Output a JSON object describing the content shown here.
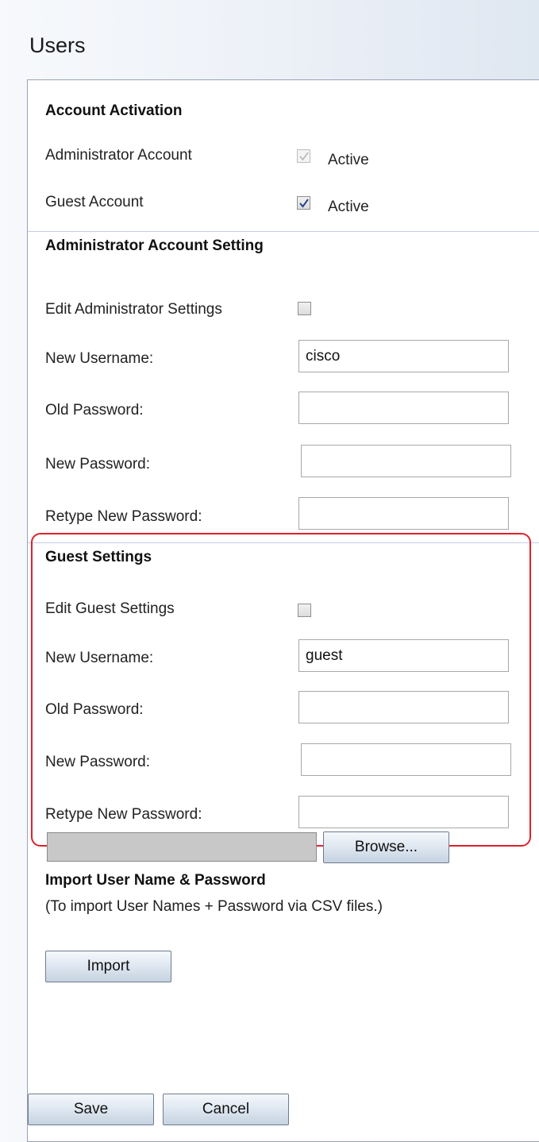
{
  "page": {
    "title": "Users"
  },
  "account_activation": {
    "title": "Account Activation",
    "admin": {
      "label": "Administrator Account",
      "active_label": "Active",
      "checked": true,
      "disabled": true
    },
    "guest": {
      "label": "Guest Account",
      "active_label": "Active",
      "checked": true,
      "disabled": false
    }
  },
  "admin_settings": {
    "title": "Administrator Account Setting",
    "edit_label": "Edit Administrator Settings",
    "edit_checked": false,
    "username_label": "New Username:",
    "username_value": "cisco",
    "old_password_label": "Old Password:",
    "new_password_label": "New Password:",
    "retype_label": "Retype New Password:"
  },
  "guest_settings": {
    "title": "Guest Settings",
    "edit_label": "Edit Guest Settings",
    "edit_checked": false,
    "username_label": "New Username:",
    "username_value": "guest",
    "old_password_label": "Old Password:",
    "new_password_label": "New Password:",
    "retype_label": "Retype New Password:"
  },
  "import": {
    "title": "Import User Name & Password",
    "browse_label": "Browse...",
    "note": "(To import User Names + Password via CSV files.)",
    "import_label": "Import"
  },
  "footer": {
    "save_label": "Save",
    "cancel_label": "Cancel"
  },
  "colors": {
    "highlight": "#e0202a",
    "divider": "#c8cde6"
  }
}
